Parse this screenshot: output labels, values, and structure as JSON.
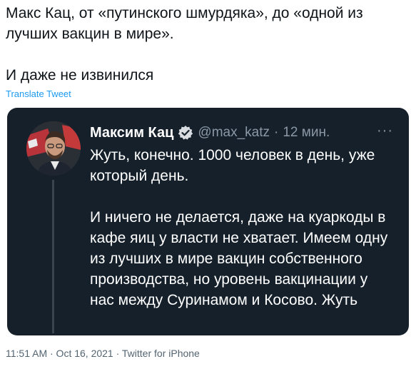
{
  "tweet": {
    "text": "Макс Кац, от «путинского шмурдяка», до «одной из лучших вакцин в мире».\n\nИ даже не извинился",
    "translate_label": "Translate Tweet",
    "meta": "11:51 AM · Oct 16, 2021 · Twitter for iPhone"
  },
  "embedded": {
    "author": "Максим Кац",
    "handle": "@max_katz",
    "separator": "·",
    "time": "12 мин.",
    "more_label": "···",
    "body": "Жуть, конечно. 1000 человек в день, уже который день.\n\nИ ничего не делается, даже на куаркоды в кафе яиц у власти не хватает. Имеем одну из лучших в мире вакцин собственного производства, но уровень вакцинации у нас между Суринамом и Косово. Жуть"
  },
  "colors": {
    "card_bg": "#15202b",
    "accent": "#1d9bf0",
    "muted": "#8b98a5"
  },
  "icons": {
    "verified": "verified-badge-icon",
    "more": "more-options-icon"
  }
}
